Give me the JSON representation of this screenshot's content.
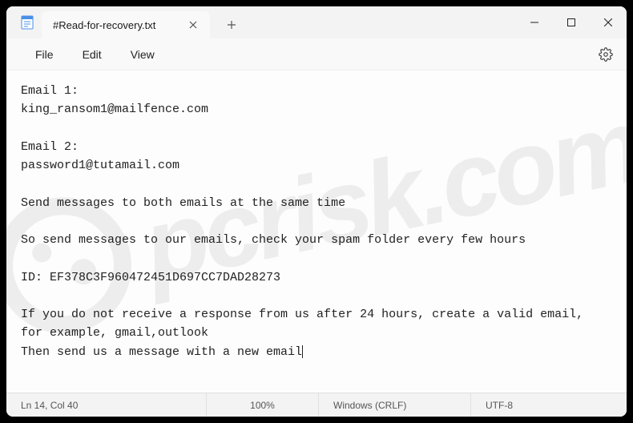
{
  "titlebar": {
    "tab_title": "#Read-for-recovery.txt"
  },
  "menu": {
    "file": "File",
    "edit": "Edit",
    "view": "View"
  },
  "document": {
    "lines": [
      "Email 1:",
      "king_ransom1@mailfence.com",
      "",
      "Email 2:",
      "password1@tutamail.com",
      "",
      "Send messages to both emails at the same time",
      "",
      "So send messages to our emails, check your spam folder every few hours",
      "",
      "ID: EF378C3F960472451D697CC7DAD28273",
      "",
      "If you do not receive a response from us after 24 hours, create a valid email, for example, gmail,outlook",
      "Then send us a message with a new email"
    ]
  },
  "statusbar": {
    "position": "Ln 14, Col 40",
    "zoom": "100%",
    "line_ending": "Windows (CRLF)",
    "encoding": "UTF-8"
  },
  "watermark": {
    "text": "pcrisk.com"
  }
}
